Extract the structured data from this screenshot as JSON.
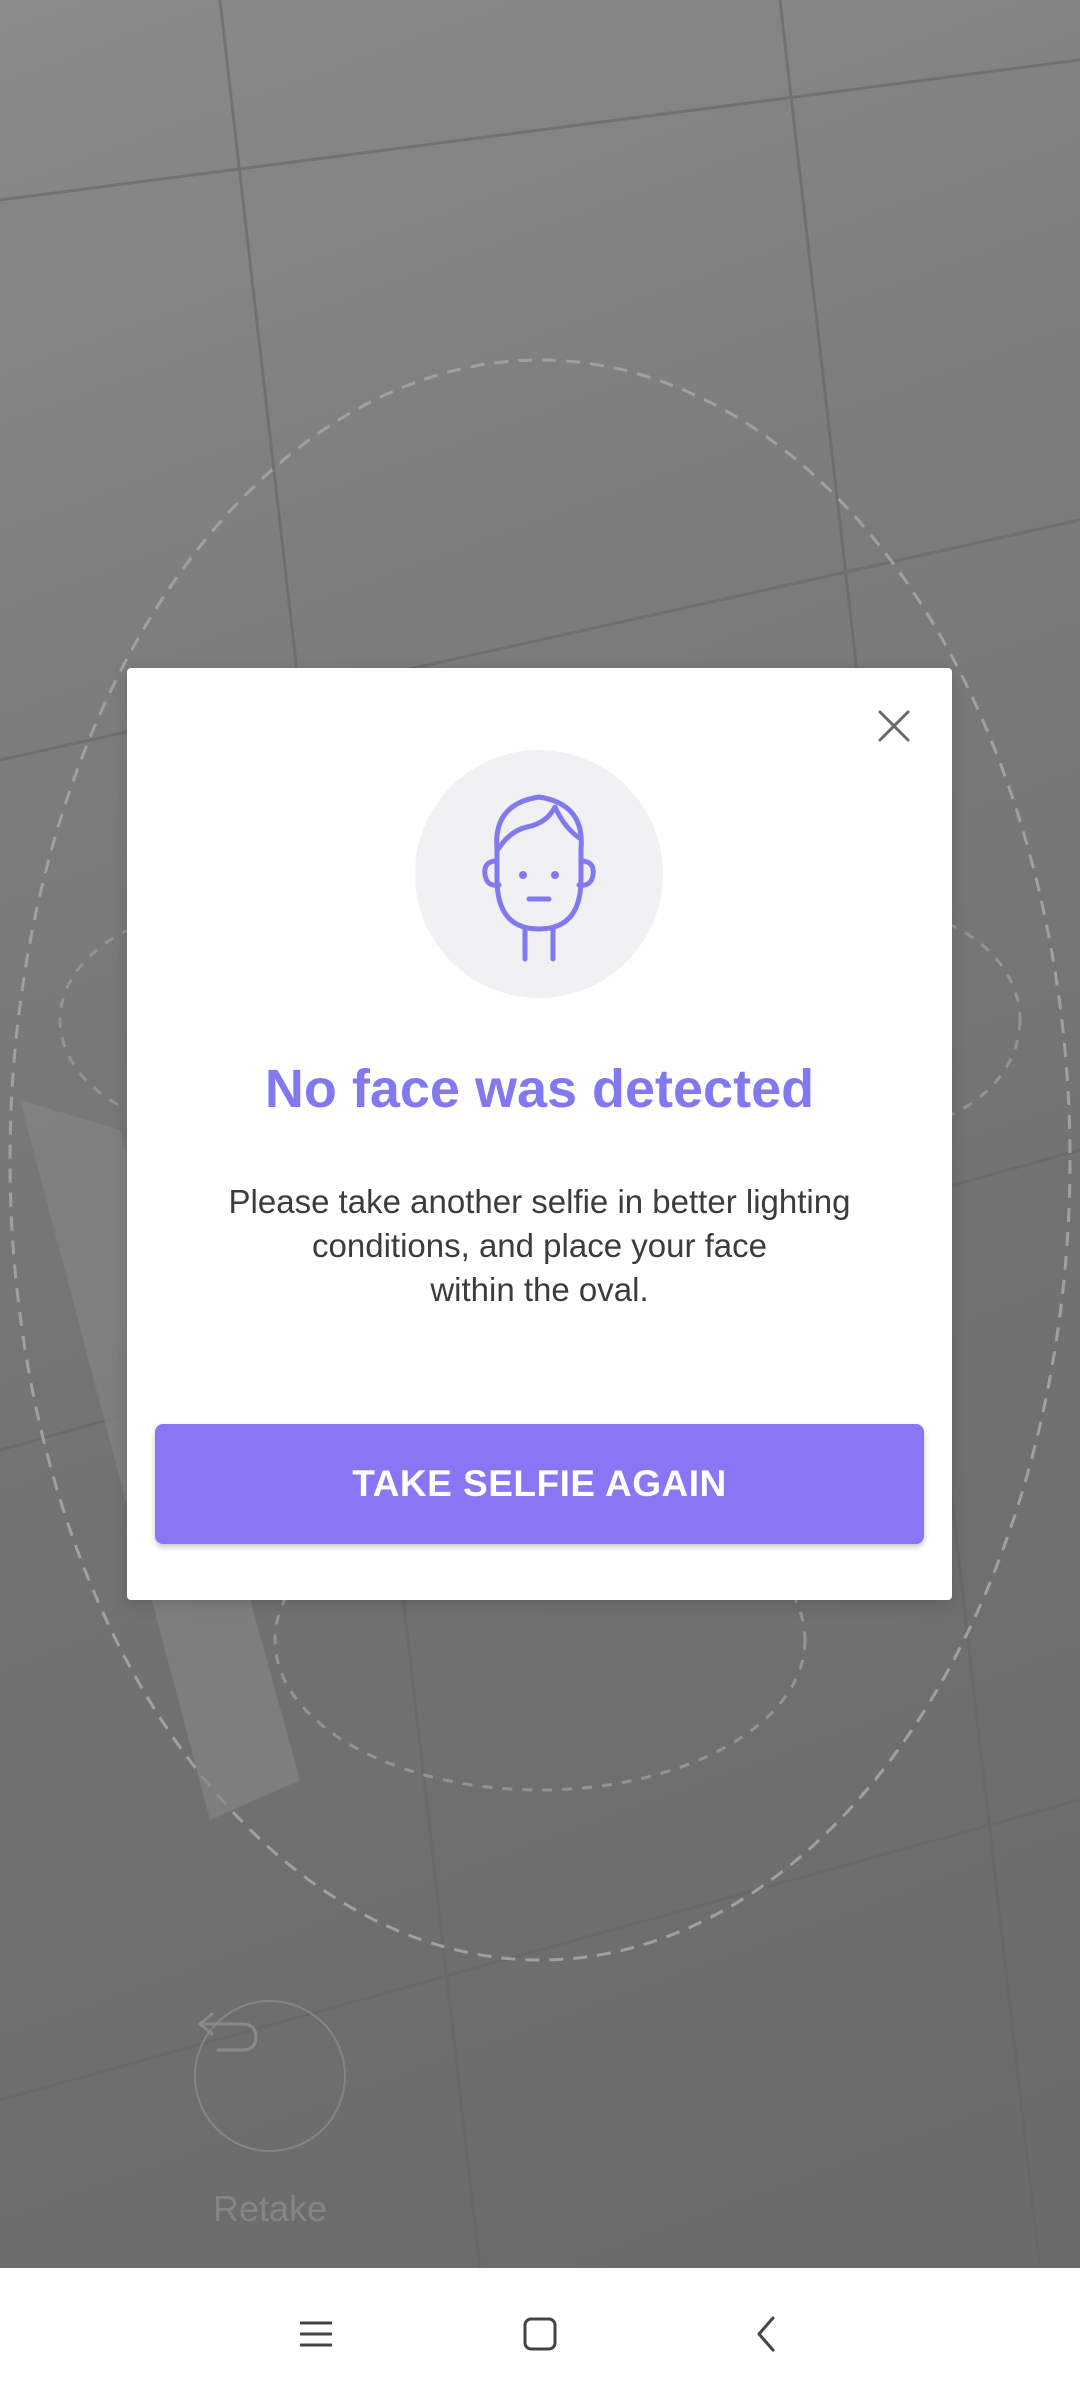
{
  "camera": {
    "retake_label": "Retake"
  },
  "dialog": {
    "title": "No face was detected",
    "message_lines": [
      "Please take another selfie in better lighting",
      "conditions, and place your face",
      "within the oval."
    ],
    "primary_button": "TAKE SELFIE AGAIN",
    "close_icon": "close-icon",
    "illustration_icon": "face-icon"
  },
  "nav": {
    "menu_icon": "menu-icon",
    "home_icon": "home-square-icon",
    "back_icon": "back-chevron-icon"
  },
  "colors": {
    "accent_title": "#8279f0",
    "accent_button": "#8a75f4",
    "overlay": "#707070"
  }
}
